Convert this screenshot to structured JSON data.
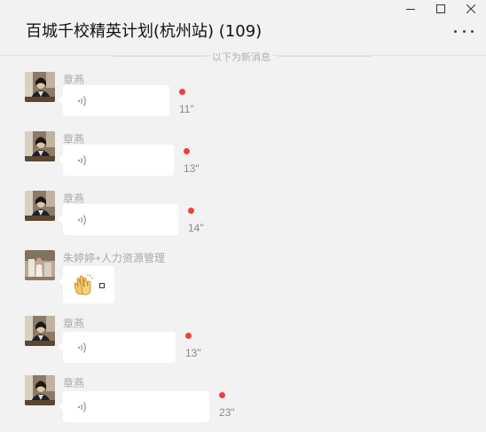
{
  "window": {
    "title": "百城千校精英计划(杭州站) (109)",
    "controls": [
      "minimize-icon",
      "maximize-icon",
      "close-icon"
    ],
    "more_icon": "more-dots-icon"
  },
  "divider": {
    "text": "以下为新消息"
  },
  "messages": [
    {
      "sender": "章燕",
      "type": "voice",
      "duration": "11\"",
      "unread": true
    },
    {
      "sender": "章燕",
      "type": "voice",
      "duration": "13\"",
      "unread": true
    },
    {
      "sender": "章燕",
      "type": "voice",
      "duration": "14\"",
      "unread": true
    },
    {
      "sender": "朱婷婷+人力资源管理",
      "type": "emoji",
      "icon": "clapping-hands-icon"
    },
    {
      "sender": "章燕",
      "type": "voice",
      "duration": "13\"",
      "unread": true
    },
    {
      "sender": "章燕",
      "type": "voice",
      "duration": "23\"",
      "unread": true
    }
  ],
  "colors": {
    "background": "#f2f2f2",
    "bubble": "#ffffff",
    "unread_dot": "#ef3f3b"
  }
}
